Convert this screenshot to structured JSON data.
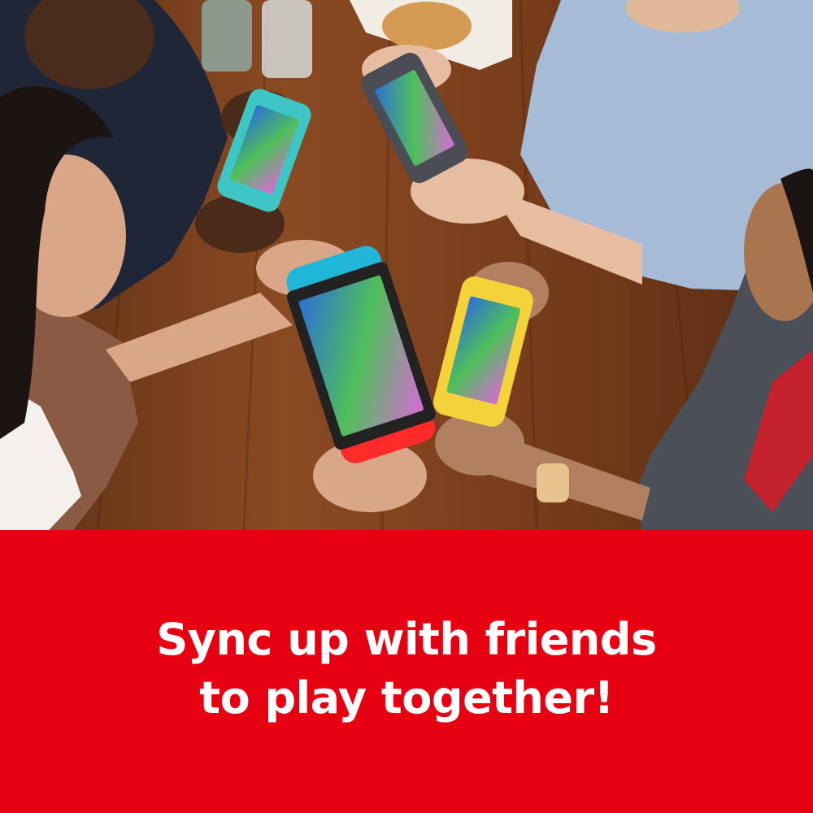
{
  "banner": {
    "line1": "Sync up with friends",
    "line2": "to play together!"
  },
  "colors": {
    "banner_red": "#e60012",
    "text": "#ffffff",
    "table_wood": "#7a3f1d",
    "console_blue": "#1fb6d8",
    "console_red": "#ff2a2a",
    "console_yellow": "#f3d23a",
    "console_turquoise": "#3ec6c4",
    "console_gray": "#4a4d55"
  },
  "photo": {
    "subject": "four-friends-playing-handheld-consoles"
  }
}
